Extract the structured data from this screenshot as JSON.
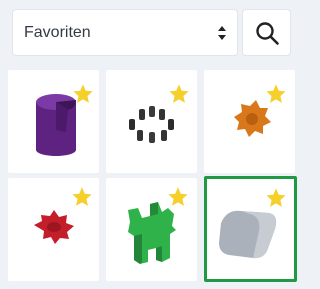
{
  "header": {
    "category_select": {
      "value": "Favoriten"
    },
    "search_button": {
      "icon": "search-icon"
    }
  },
  "favorites": {
    "star_color": "#f5cf2a",
    "selected_border_color": "#1f9a43",
    "items": [
      {
        "shape": "purple-cylinder-notched",
        "color": "#6a2a8a",
        "favorited": true,
        "selected": false
      },
      {
        "shape": "black-ring-of-pegs",
        "color": "#333333",
        "favorited": true,
        "selected": false
      },
      {
        "shape": "orange-gear",
        "color": "#d97a1c",
        "favorited": true,
        "selected": false
      },
      {
        "shape": "red-gear",
        "color": "#c31f2a",
        "favorited": true,
        "selected": false
      },
      {
        "shape": "green-extruded-profile",
        "color": "#2fb34a",
        "favorited": true,
        "selected": false
      },
      {
        "shape": "gray-rounded-block",
        "color": "#a9b0b8",
        "favorited": true,
        "selected": true
      }
    ]
  }
}
